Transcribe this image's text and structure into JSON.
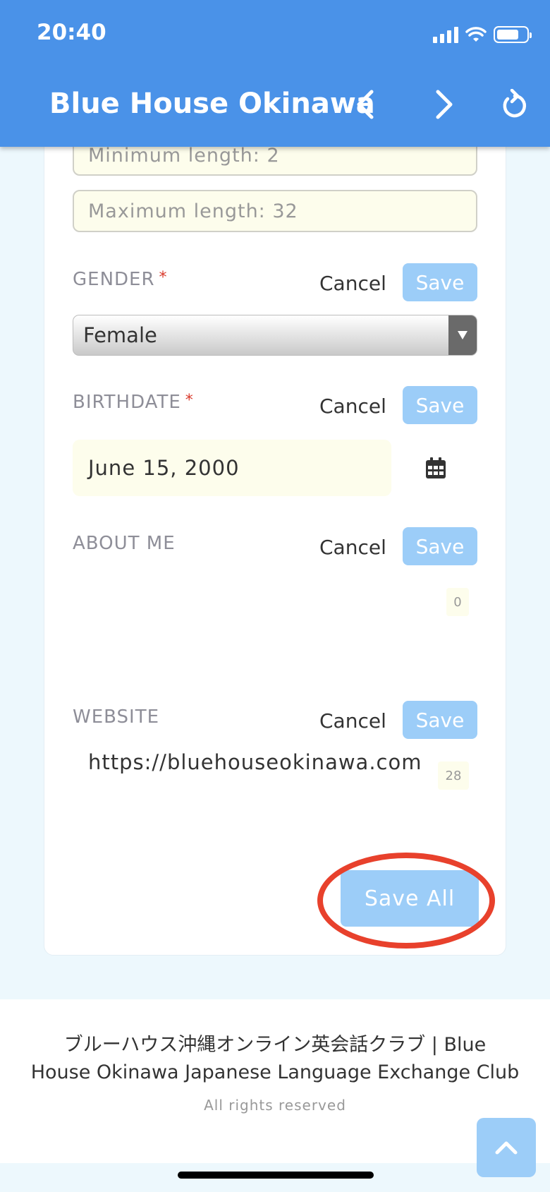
{
  "status_bar": {
    "time": "20:40"
  },
  "header": {
    "title": "Blue House Okinawa",
    "back_icon": "chevron-left-icon",
    "forward_icon": "chevron-right-icon",
    "reload_icon": "reload-icon"
  },
  "form": {
    "min_length_placeholder": "Minimum length: 2",
    "max_length_placeholder": "Maximum length: 32",
    "gender": {
      "label": "GENDER",
      "required": "*",
      "cancel": "Cancel",
      "save": "Save",
      "value": "Female"
    },
    "birthdate": {
      "label": "BIRTHDATE",
      "required": "*",
      "cancel": "Cancel",
      "save": "Save",
      "value": "June 15, 2000"
    },
    "about_me": {
      "label": "ABOUT ME",
      "cancel": "Cancel",
      "save": "Save",
      "counter": "0"
    },
    "website": {
      "label": "WEBSITE",
      "cancel": "Cancel",
      "save": "Save",
      "value": "https://bluehouseokinawa.com",
      "counter": "28"
    },
    "save_all": "Save All"
  },
  "footer": {
    "line1": "ブルーハウス沖縄オンライン英会話クラブ | Blue",
    "line2": "House Okinawa Japanese Language Exchange Club",
    "rights": "All rights reserved"
  },
  "colors": {
    "header_bg": "#4a92e8",
    "save_button_bg": "#9ccdf8",
    "highlight_ring": "#e8412c",
    "required_mark": "#d9392b"
  }
}
